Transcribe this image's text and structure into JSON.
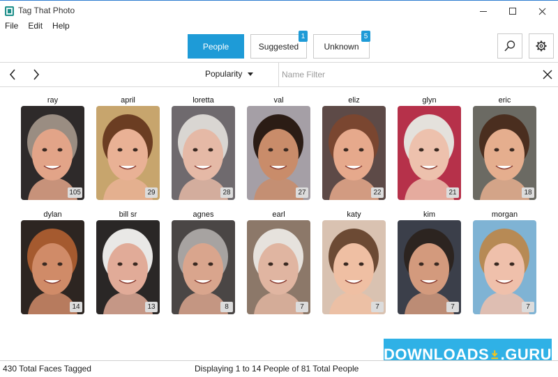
{
  "window": {
    "title": "Tag That Photo"
  },
  "menu": [
    "File",
    "Edit",
    "Help"
  ],
  "tabs": [
    {
      "label": "People",
      "badge": null,
      "selected": true
    },
    {
      "label": "Suggested",
      "badge": "1",
      "selected": false
    },
    {
      "label": "Unknown",
      "badge": "5",
      "selected": false
    }
  ],
  "toolbar": {
    "sort_label": "Popularity",
    "filter_placeholder": "Name Filter",
    "filter_value": ""
  },
  "icons": {
    "search": "search-icon",
    "settings": "gear-icon",
    "back": "chevron-left-icon",
    "forward": "chevron-right-icon",
    "clear": "close-icon"
  },
  "colors": {
    "accent": "#1e9bd7",
    "watermark": "#2fb1e6"
  },
  "people": [
    {
      "name": "ray",
      "count": "105",
      "skin": "#e2a488",
      "hair": "#9a8d82",
      "bg": "#2e2a2a"
    },
    {
      "name": "april",
      "count": "29",
      "skin": "#e9b195",
      "hair": "#6b3d22",
      "bg": "#c7a56d"
    },
    {
      "name": "loretta",
      "count": "28",
      "skin": "#e5b9a6",
      "hair": "#d9d6d2",
      "bg": "#6f6a6e"
    },
    {
      "name": "val",
      "count": "27",
      "skin": "#c98c6a",
      "hair": "#2b1c15",
      "bg": "#a59fa6"
    },
    {
      "name": "eliz",
      "count": "22",
      "skin": "#e6a98c",
      "hair": "#7a4630",
      "bg": "#5d4a47"
    },
    {
      "name": "glyn",
      "count": "21",
      "skin": "#edc1ad",
      "hair": "#e4e1dc",
      "bg": "#b6314a"
    },
    {
      "name": "eric",
      "count": "18",
      "skin": "#e5ae8e",
      "hair": "#4a2e1f",
      "bg": "#6b6a63"
    },
    {
      "name": "dylan",
      "count": "14",
      "skin": "#d08b68",
      "hair": "#a55a2f",
      "bg": "#2d2521"
    },
    {
      "name": "bill sr",
      "count": "13",
      "skin": "#e1ab98",
      "hair": "#e9e8e6",
      "bg": "#2a2726"
    },
    {
      "name": "agnes",
      "count": "8",
      "skin": "#d9a58d",
      "hair": "#a7a3a1",
      "bg": "#4a4645"
    },
    {
      "name": "earl",
      "count": "7",
      "skin": "#e0b5a1",
      "hair": "#e6e2dd",
      "bg": "#8c7869"
    },
    {
      "name": "katy",
      "count": "7",
      "skin": "#efbfa3",
      "hair": "#6c4a34",
      "bg": "#d9c2b1"
    },
    {
      "name": "kim",
      "count": "7",
      "skin": "#d39a7d",
      "hair": "#2c2420",
      "bg": "#3b3f4a"
    },
    {
      "name": "morgan",
      "count": "7",
      "skin": "#efc0ab",
      "hair": "#b78a55",
      "bg": "#7fb3d4"
    }
  ],
  "watermark": {
    "text": "DOWNLOADS",
    "suffix": ".GURU"
  },
  "status": {
    "left": "430 Total Faces Tagged",
    "center": "Displaying 1 to 14 People of 81 Total People"
  }
}
